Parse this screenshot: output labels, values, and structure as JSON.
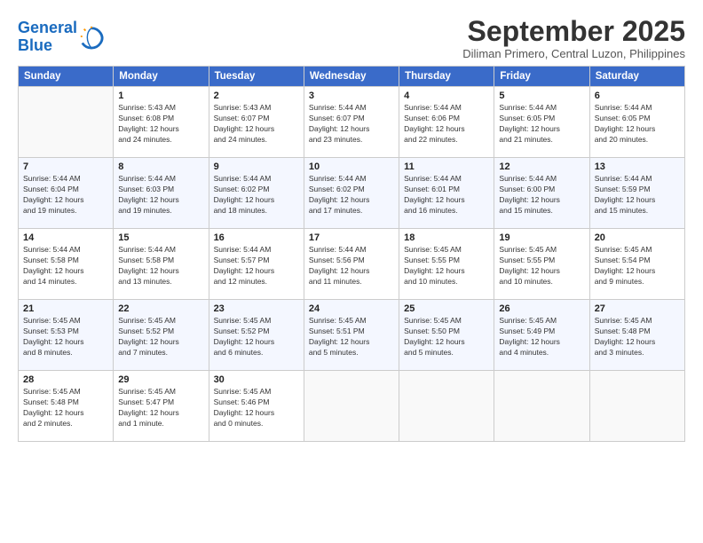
{
  "logo": {
    "line1": "General",
    "line2": "Blue"
  },
  "title": "September 2025",
  "location": "Diliman Primero, Central Luzon, Philippines",
  "days_of_week": [
    "Sunday",
    "Monday",
    "Tuesday",
    "Wednesday",
    "Thursday",
    "Friday",
    "Saturday"
  ],
  "weeks": [
    [
      {
        "day": "",
        "info": ""
      },
      {
        "day": "1",
        "info": "Sunrise: 5:43 AM\nSunset: 6:08 PM\nDaylight: 12 hours\nand 24 minutes."
      },
      {
        "day": "2",
        "info": "Sunrise: 5:43 AM\nSunset: 6:07 PM\nDaylight: 12 hours\nand 24 minutes."
      },
      {
        "day": "3",
        "info": "Sunrise: 5:44 AM\nSunset: 6:07 PM\nDaylight: 12 hours\nand 23 minutes."
      },
      {
        "day": "4",
        "info": "Sunrise: 5:44 AM\nSunset: 6:06 PM\nDaylight: 12 hours\nand 22 minutes."
      },
      {
        "day": "5",
        "info": "Sunrise: 5:44 AM\nSunset: 6:05 PM\nDaylight: 12 hours\nand 21 minutes."
      },
      {
        "day": "6",
        "info": "Sunrise: 5:44 AM\nSunset: 6:05 PM\nDaylight: 12 hours\nand 20 minutes."
      }
    ],
    [
      {
        "day": "7",
        "info": "Sunrise: 5:44 AM\nSunset: 6:04 PM\nDaylight: 12 hours\nand 19 minutes."
      },
      {
        "day": "8",
        "info": "Sunrise: 5:44 AM\nSunset: 6:03 PM\nDaylight: 12 hours\nand 19 minutes."
      },
      {
        "day": "9",
        "info": "Sunrise: 5:44 AM\nSunset: 6:02 PM\nDaylight: 12 hours\nand 18 minutes."
      },
      {
        "day": "10",
        "info": "Sunrise: 5:44 AM\nSunset: 6:02 PM\nDaylight: 12 hours\nand 17 minutes."
      },
      {
        "day": "11",
        "info": "Sunrise: 5:44 AM\nSunset: 6:01 PM\nDaylight: 12 hours\nand 16 minutes."
      },
      {
        "day": "12",
        "info": "Sunrise: 5:44 AM\nSunset: 6:00 PM\nDaylight: 12 hours\nand 15 minutes."
      },
      {
        "day": "13",
        "info": "Sunrise: 5:44 AM\nSunset: 5:59 PM\nDaylight: 12 hours\nand 15 minutes."
      }
    ],
    [
      {
        "day": "14",
        "info": "Sunrise: 5:44 AM\nSunset: 5:58 PM\nDaylight: 12 hours\nand 14 minutes."
      },
      {
        "day": "15",
        "info": "Sunrise: 5:44 AM\nSunset: 5:58 PM\nDaylight: 12 hours\nand 13 minutes."
      },
      {
        "day": "16",
        "info": "Sunrise: 5:44 AM\nSunset: 5:57 PM\nDaylight: 12 hours\nand 12 minutes."
      },
      {
        "day": "17",
        "info": "Sunrise: 5:44 AM\nSunset: 5:56 PM\nDaylight: 12 hours\nand 11 minutes."
      },
      {
        "day": "18",
        "info": "Sunrise: 5:45 AM\nSunset: 5:55 PM\nDaylight: 12 hours\nand 10 minutes."
      },
      {
        "day": "19",
        "info": "Sunrise: 5:45 AM\nSunset: 5:55 PM\nDaylight: 12 hours\nand 10 minutes."
      },
      {
        "day": "20",
        "info": "Sunrise: 5:45 AM\nSunset: 5:54 PM\nDaylight: 12 hours\nand 9 minutes."
      }
    ],
    [
      {
        "day": "21",
        "info": "Sunrise: 5:45 AM\nSunset: 5:53 PM\nDaylight: 12 hours\nand 8 minutes."
      },
      {
        "day": "22",
        "info": "Sunrise: 5:45 AM\nSunset: 5:52 PM\nDaylight: 12 hours\nand 7 minutes."
      },
      {
        "day": "23",
        "info": "Sunrise: 5:45 AM\nSunset: 5:52 PM\nDaylight: 12 hours\nand 6 minutes."
      },
      {
        "day": "24",
        "info": "Sunrise: 5:45 AM\nSunset: 5:51 PM\nDaylight: 12 hours\nand 5 minutes."
      },
      {
        "day": "25",
        "info": "Sunrise: 5:45 AM\nSunset: 5:50 PM\nDaylight: 12 hours\nand 5 minutes."
      },
      {
        "day": "26",
        "info": "Sunrise: 5:45 AM\nSunset: 5:49 PM\nDaylight: 12 hours\nand 4 minutes."
      },
      {
        "day": "27",
        "info": "Sunrise: 5:45 AM\nSunset: 5:48 PM\nDaylight: 12 hours\nand 3 minutes."
      }
    ],
    [
      {
        "day": "28",
        "info": "Sunrise: 5:45 AM\nSunset: 5:48 PM\nDaylight: 12 hours\nand 2 minutes."
      },
      {
        "day": "29",
        "info": "Sunrise: 5:45 AM\nSunset: 5:47 PM\nDaylight: 12 hours\nand 1 minute."
      },
      {
        "day": "30",
        "info": "Sunrise: 5:45 AM\nSunset: 5:46 PM\nDaylight: 12 hours\nand 0 minutes."
      },
      {
        "day": "",
        "info": ""
      },
      {
        "day": "",
        "info": ""
      },
      {
        "day": "",
        "info": ""
      },
      {
        "day": "",
        "info": ""
      }
    ]
  ]
}
